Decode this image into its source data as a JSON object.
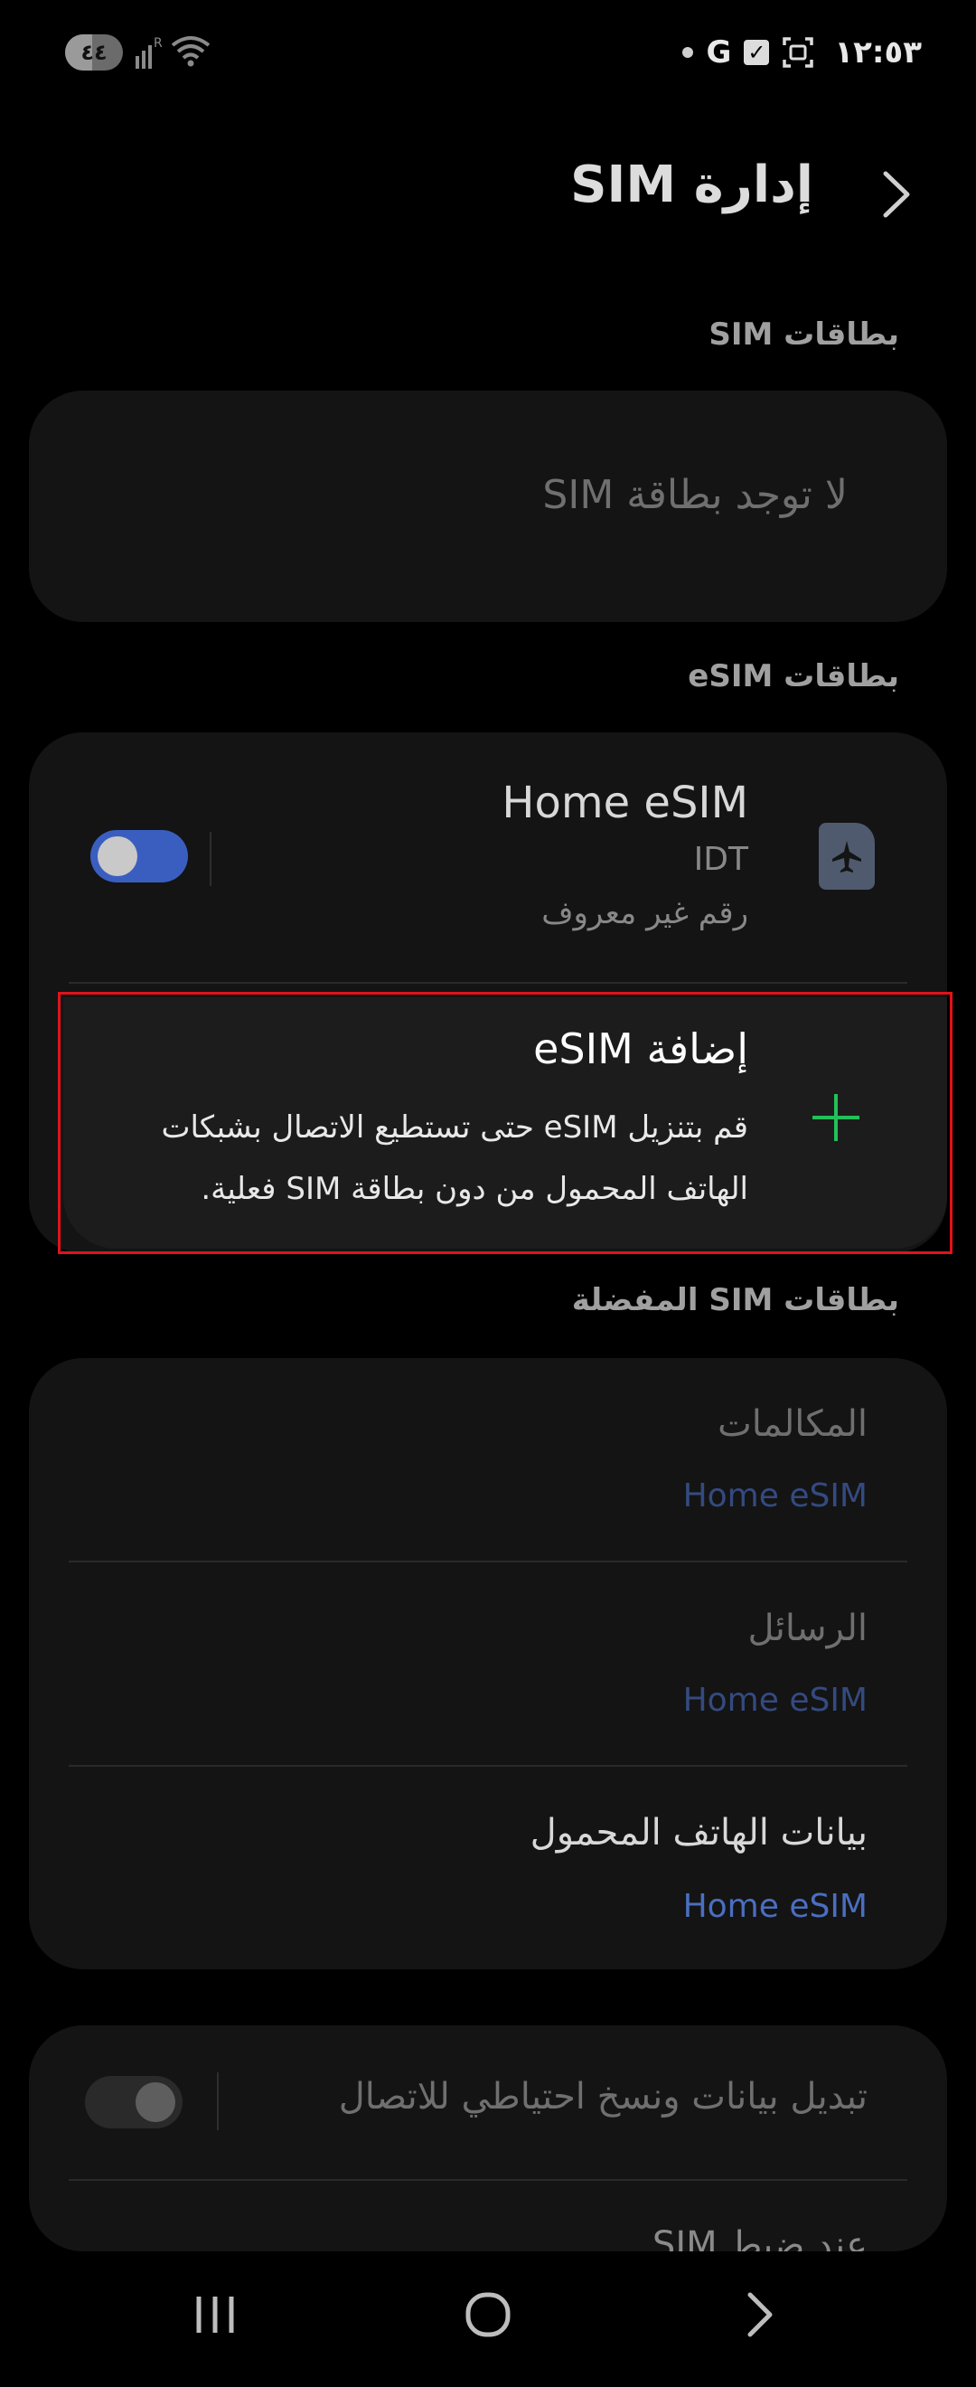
{
  "status_bar": {
    "battery_level": "٤٤",
    "time": "١٢:٥٣",
    "icons": [
      "battery-icon",
      "signal-icon",
      "wifi-icon",
      "dot-icon",
      "google-icon",
      "checkbox-icon",
      "screenshot-icon"
    ]
  },
  "header": {
    "title": "إدارة SIM",
    "back_icon": "chevron-right-icon"
  },
  "sim_section": {
    "label": "بطاقات SIM",
    "empty_text": "لا توجد بطاقة SIM"
  },
  "esim_section": {
    "label": "بطاقات eSIM",
    "esim": {
      "name": "Home eSIM",
      "carrier": "IDT",
      "number": "رقم غير معروف",
      "enabled": true,
      "icon": "airplane-sim-icon"
    },
    "add": {
      "title": "إضافة eSIM",
      "description": "قم بتنزيل eSIM حتى تستطيع الاتصال بشبكات الهاتف المحمول من دون بطاقة SIM فعلية.",
      "icon": "plus-icon"
    }
  },
  "preferred_section": {
    "label": "بطاقات SIM المفضلة",
    "items": [
      {
        "title": "المكالمات",
        "value": "Home eSIM"
      },
      {
        "title": "الرسائل",
        "value": "Home eSIM"
      },
      {
        "title": "بيانات الهاتف المحمول",
        "value": "Home eSIM"
      }
    ]
  },
  "backup": {
    "label": "تبديل بيانات ونسخ احتياطي للاتصال",
    "enabled": false,
    "next_label_partial": "عند ضبط SIM"
  },
  "colors": {
    "accent_blue": "#3a5ec0",
    "value_blue": "#4a6ec0",
    "add_green": "#23c05a",
    "highlight_red": "#e0131b"
  },
  "nav": {
    "recents": "recents-icon",
    "home": "home-icon",
    "back": "back-icon"
  }
}
